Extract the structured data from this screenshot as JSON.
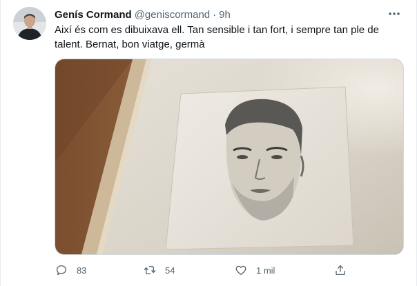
{
  "tweet": {
    "display_name": "Genís Cormand",
    "handle": "@geniscormand",
    "separator": "·",
    "time": "9h",
    "text": "Així és com es dibuixava ell. Tan sensible i tan fort, i sempre tan ple de talent. Bernat, bon viatge, germà",
    "media": {
      "description_icon": "framed-pencil-portrait-photo"
    },
    "actions": {
      "reply_count": "83",
      "retweet_count": "54",
      "like_count": "1 mil"
    }
  },
  "colors": {
    "text_primary": "#0f1419",
    "text_secondary": "#536471",
    "border": "#cfd9de"
  },
  "icons": {
    "more": "more-horizontal-icon",
    "reply": "reply-icon",
    "retweet": "retweet-icon",
    "like": "heart-icon",
    "share": "share-icon"
  }
}
